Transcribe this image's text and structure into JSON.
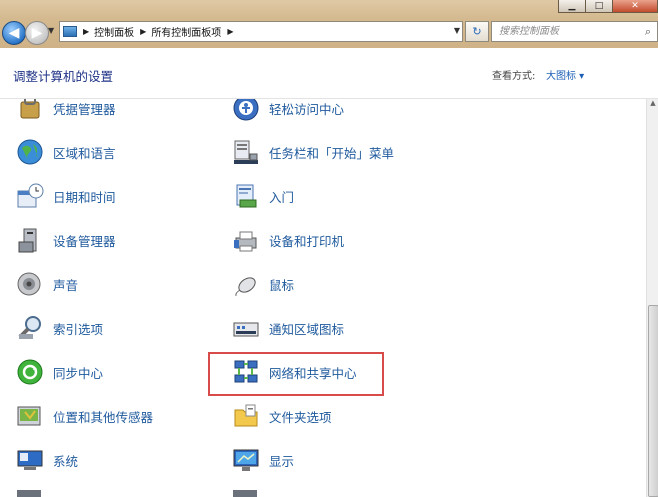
{
  "window": {
    "minimize_glyph": "▁",
    "maximize_glyph": "□",
    "close_glyph": "✕"
  },
  "nav": {
    "back_glyph": "◀",
    "forward_glyph": "▶",
    "refresh_glyph": "↻",
    "breadcrumbs": [
      "控制面板",
      "所有控制面板项"
    ],
    "search_placeholder": "搜索控制面板"
  },
  "header": {
    "title": "调整计算机的设置",
    "view_by_label": "查看方式:",
    "view_by_value": "大图标 ▾"
  },
  "items_left": [
    {
      "label": "凭据管理器",
      "icon": "credential-manager-icon"
    },
    {
      "label": "区域和语言",
      "icon": "region-language-icon"
    },
    {
      "label": "日期和时间",
      "icon": "date-time-icon"
    },
    {
      "label": "设备管理器",
      "icon": "device-manager-icon"
    },
    {
      "label": "声音",
      "icon": "sound-icon"
    },
    {
      "label": "索引选项",
      "icon": "indexing-options-icon"
    },
    {
      "label": "同步中心",
      "icon": "sync-center-icon"
    },
    {
      "label": "位置和其他传感器",
      "icon": "location-sensors-icon"
    },
    {
      "label": "系统",
      "icon": "system-icon"
    }
  ],
  "items_right": [
    {
      "label": "轻松访问中心",
      "icon": "ease-of-access-icon"
    },
    {
      "label": "任务栏和「开始」菜单",
      "icon": "taskbar-start-menu-icon"
    },
    {
      "label": "入门",
      "icon": "getting-started-icon"
    },
    {
      "label": "设备和打印机",
      "icon": "devices-printers-icon"
    },
    {
      "label": "鼠标",
      "icon": "mouse-icon"
    },
    {
      "label": "通知区域图标",
      "icon": "notification-area-icon"
    },
    {
      "label": "网络和共享中心",
      "icon": "network-sharing-icon"
    },
    {
      "label": "文件夹选项",
      "icon": "folder-options-icon"
    },
    {
      "label": "显示",
      "icon": "display-icon"
    }
  ],
  "highlighted_item": "网络和共享中心"
}
